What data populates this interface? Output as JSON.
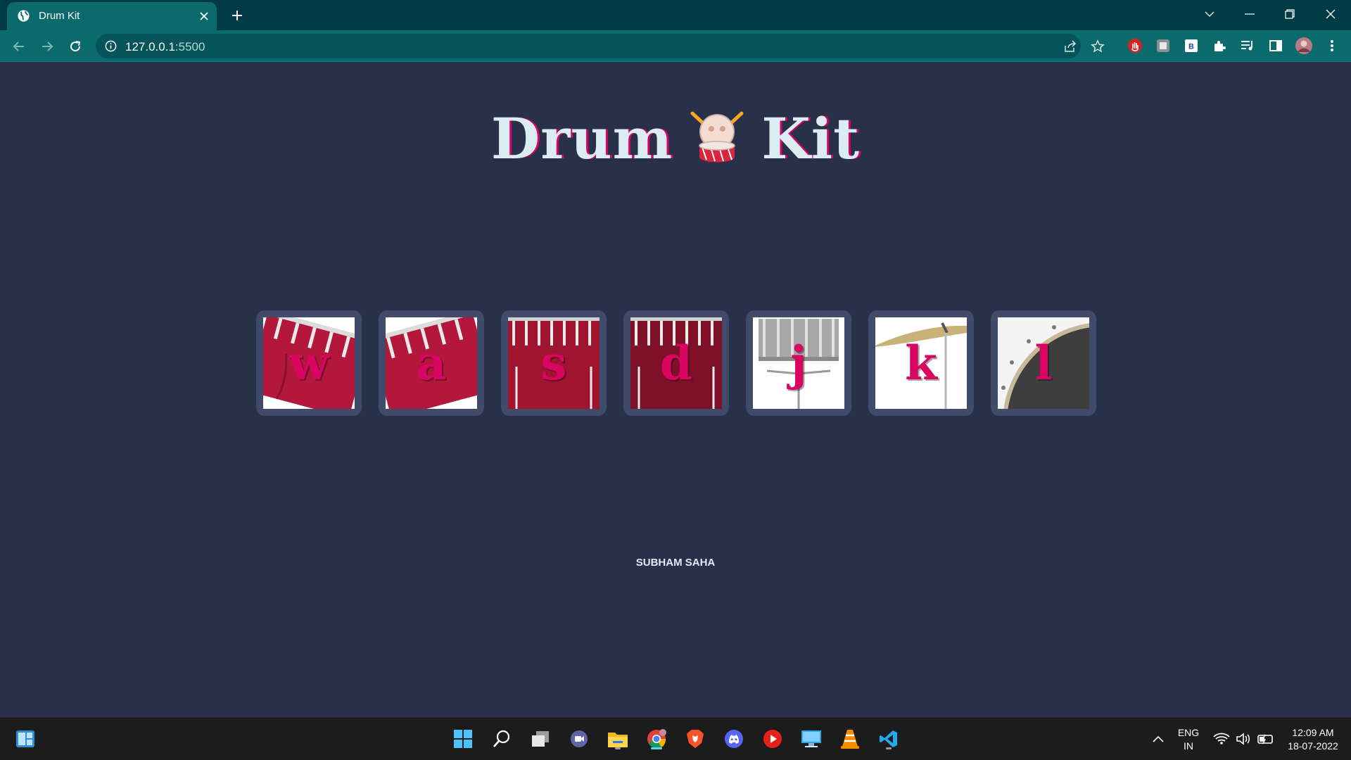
{
  "browser": {
    "tab_title": "Drum Kit",
    "url_host": "127.0.0.1",
    "url_port": ":5500"
  },
  "page": {
    "title_word1": "Drum",
    "title_word2": "Kit",
    "keys": [
      {
        "letter": "w",
        "instrument": "tom-1"
      },
      {
        "letter": "a",
        "instrument": "tom-2"
      },
      {
        "letter": "s",
        "instrument": "tom-3"
      },
      {
        "letter": "d",
        "instrument": "tom-4"
      },
      {
        "letter": "j",
        "instrument": "snare"
      },
      {
        "letter": "k",
        "instrument": "crash"
      },
      {
        "letter": "l",
        "instrument": "kick-bass"
      }
    ],
    "footer": "SUBHAM SAHA",
    "colors": {
      "background": "#283149",
      "accent": "#da0463",
      "text": "#dbedf3",
      "key_frame": "#404b69"
    }
  },
  "taskbar": {
    "lang_line1": "ENG",
    "lang_line2": "IN",
    "time": "12:09 AM",
    "date": "18-07-2022",
    "apps": [
      "start-icon",
      "search-icon",
      "task-view-icon",
      "teams-chat-icon",
      "file-explorer-icon",
      "chrome-icon",
      "brave-icon",
      "discord-icon",
      "youtube-music-icon",
      "remote-desktop-icon",
      "vlc-icon",
      "vscode-icon"
    ]
  }
}
